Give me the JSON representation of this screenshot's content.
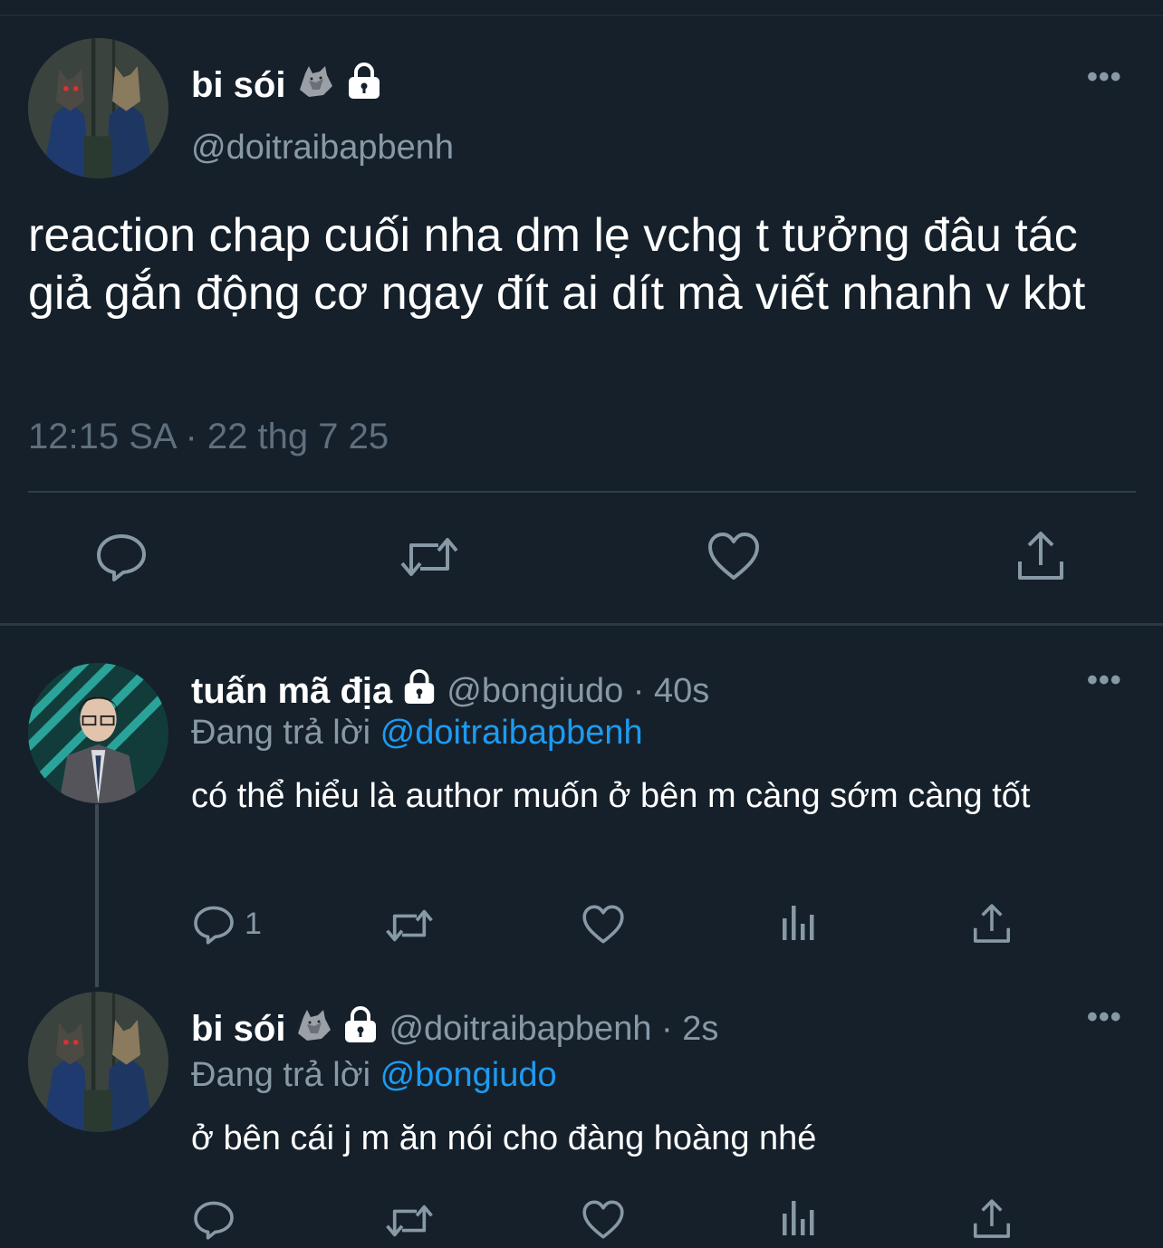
{
  "main_tweet": {
    "author_name": "bi sói",
    "handle": "@doitraibapbenh",
    "text": "reaction chap cuối nha dm lẹ vchg t tưởng đâu tác giả gắn động cơ ngay đít ai dít mà viết nhanh v kbt",
    "timestamp": "12:15 SA · 22 thg 7 25",
    "more_label": "•••",
    "actions": [
      "comment-icon",
      "retweet-icon",
      "heart-icon",
      "share-icon"
    ]
  },
  "replies": [
    {
      "author_name": "tuấn mã địa",
      "handle_time": "@bongiudo · 40s",
      "replying_prefix": "Đang trả lời",
      "replying_to": "@doitraibapbenh",
      "text": "có thể hiểu là author muốn ở bên m càng sớm càng tốt",
      "reply_count": "1",
      "more_label": "•••"
    },
    {
      "author_name": "bi sói",
      "handle_time": "@doitraibapbenh · 2s",
      "replying_prefix": "Đang trả lời",
      "replying_to": "@bongiudo",
      "text": "ở bên cái j m ăn nói cho đàng hoàng nhé",
      "more_label": "•••"
    }
  ],
  "colors": {
    "background": "#15202b",
    "text": "#ffffff",
    "muted": "#8899a6",
    "link": "#1d9bf0"
  }
}
